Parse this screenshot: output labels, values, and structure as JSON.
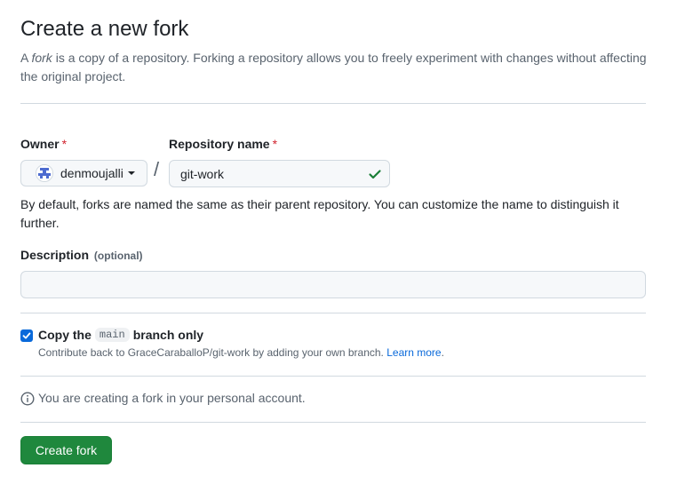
{
  "page": {
    "title": "Create a new fork",
    "intro_prefix": "A ",
    "intro_em": "fork",
    "intro_suffix": " is a copy of a repository. Forking a repository allows you to freely experiment with changes without affecting the original project."
  },
  "owner": {
    "label": "Owner",
    "required_mark": "*",
    "selected": "denmoujalli",
    "avatar_icon": "identicon-avatar"
  },
  "separator": "/",
  "repository": {
    "label": "Repository name",
    "required_mark": "*",
    "value": "git-work",
    "valid_icon": "check-icon",
    "help": "By default, forks are named the same as their parent repository. You can customize the name to distinguish it further."
  },
  "description": {
    "label": "Description",
    "optional_label": "(optional)",
    "value": "",
    "placeholder": ""
  },
  "copy_branch": {
    "checked": true,
    "label_prefix": "Copy the",
    "branch": "main",
    "label_suffix": "branch only",
    "help_text": "Contribute back to GraceCaraballoP/git-work by adding your own branch.",
    "learn_more": "Learn more",
    "help_end": "."
  },
  "info": {
    "icon": "info-icon",
    "text": "You are creating a fork in your personal account."
  },
  "actions": {
    "create_label": "Create fork"
  },
  "colors": {
    "primary_button": "#1f883d",
    "link": "#0969da",
    "checkbox": "#0969da",
    "required": "#d1242f",
    "valid_check": "#1a7f37"
  }
}
